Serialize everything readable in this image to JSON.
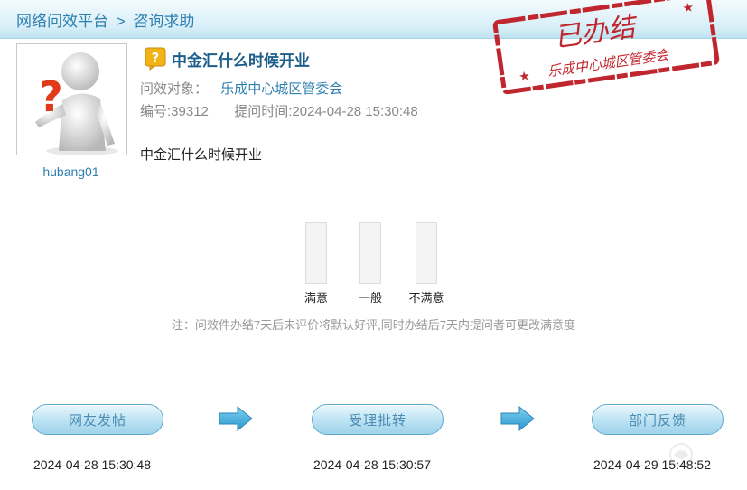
{
  "breadcrumb": {
    "root": "网络问效平台",
    "separator": ">",
    "current": "咨询求助"
  },
  "stamp": {
    "main_text": "已办结",
    "sub_text": "乐成中心城区管委会",
    "color": "#c0262d"
  },
  "user": {
    "name": "hubang01",
    "avatar_icon": "question-man-avatar"
  },
  "post": {
    "icon": "question-mark-icon",
    "title": "中金汇什么时候开业",
    "target_label": "问效对象：",
    "target_value": "乐成中心城区管委会",
    "id_text": "编号:39312",
    "time_text": "提问时间:2024-04-28 15:30:48",
    "question": "中金汇什么时候开业"
  },
  "ratings": {
    "options": [
      "满意",
      "一般",
      "不满意"
    ]
  },
  "note": "注：问效件办结7天后未评价将默认好评,同时办结后7天内提问者可更改满意度",
  "workflow": {
    "steps": [
      {
        "label": "网友发帖",
        "time": "2024-04-28 15:30:48"
      },
      {
        "label": "受理批转",
        "time": "2024-04-28 15:30:57"
      },
      {
        "label": "部门反馈",
        "time": "2024-04-29 15:48:52"
      }
    ],
    "arrow_icon": "right-arrow-icon"
  },
  "colors": {
    "link_blue": "#2e7fb0",
    "title_blue": "#1d5f8a",
    "stamp_red": "#c0262d",
    "header_bg": "#d8eff8"
  }
}
